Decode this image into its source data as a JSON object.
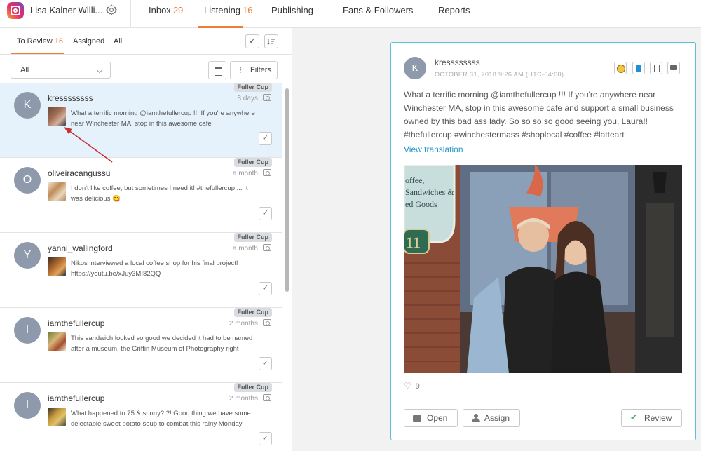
{
  "header": {
    "account_name": "Lisa Kalner Willi...",
    "tabs": [
      {
        "label": "Inbox",
        "count": "29"
      },
      {
        "label": "Listening",
        "count": "16"
      },
      {
        "label": "Publishing",
        "count": ""
      },
      {
        "label": "Fans & Followers",
        "count": ""
      },
      {
        "label": "Reports",
        "count": ""
      }
    ]
  },
  "left": {
    "subtabs": [
      {
        "label": "To Review",
        "count": "16"
      },
      {
        "label": "Assigned",
        "count": ""
      },
      {
        "label": "All",
        "count": ""
      }
    ],
    "select_value": "All",
    "filters_label": "Filters",
    "items": [
      {
        "avatar": "K",
        "username": "kressssssss",
        "time": "8 days",
        "badge": "Fuller Cup",
        "text": "What a terrific morning @iamthefullercup !!! If you're anywhere near Winchester MA, stop in this awesome cafe"
      },
      {
        "avatar": "O",
        "username": "oliveiracangussu",
        "time": "a month",
        "badge": "Fuller Cup",
        "text": "I don't like coffee, but sometimes I need it! #thefullercup ... It was delicious 😋"
      },
      {
        "avatar": "Y",
        "username": "yanni_wallingford",
        "time": "a month",
        "badge": "Fuller Cup",
        "text": "Nikos interviewed a local coffee shop for his final project! https://youtu.be/xJuy3MI82QQ"
      },
      {
        "avatar": "I",
        "username": "iamthefullercup",
        "time": "2 months",
        "badge": "Fuller Cup",
        "text": "This sandwich looked so good we decided it had to be named after a museum, the Griffin Museum of Photography right"
      },
      {
        "avatar": "I",
        "username": "iamthefullercup",
        "time": "2 months",
        "badge": "Fuller Cup",
        "text": "What happened to 75 & sunny?!?! Good thing we have some delectable sweet potato soup to combat this rainy Monday"
      }
    ]
  },
  "detail": {
    "avatar": "K",
    "username": "kressssssss",
    "date": "OCTOBER 31, 2018 9:26 AM (UTC-04:00)",
    "body": "What a terrific morning @iamthefullercup !!! If you're anywhere near Winchester MA, stop in this awesome cafe and support a small business owned by this bad ass lady. So so so so good seeing you, Laura!! #thefullercup #winchestermass #shoplocal #coffee #latteart",
    "translate_label": "View translation",
    "photo_sign": [
      "offee,",
      "Sandwiches &",
      "ed Goods"
    ],
    "photo_number": "11",
    "likes": "9",
    "open_label": "Open",
    "assign_label": "Assign",
    "review_label": "Review"
  },
  "colors": {
    "accent": "#f07a37",
    "link": "#2196c9",
    "selected_row": "#e5f1fb",
    "card_border": "#5bc0d6",
    "review_check": "#3db76b"
  }
}
